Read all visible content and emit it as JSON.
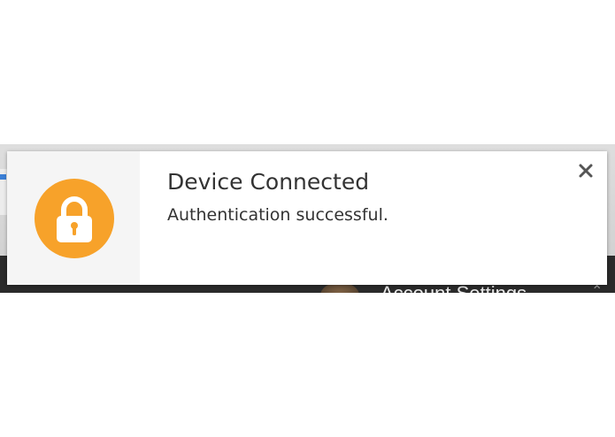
{
  "notification": {
    "title": "Device Connected",
    "message": "Authentication successful.",
    "icon": "lock-icon",
    "close_icon": "close-icon"
  },
  "background_window": {
    "account_text": "Account Settings"
  },
  "colors": {
    "lock_circle": "#f7a22a",
    "icon_panel_bg": "#f5f5f5",
    "text": "#333333",
    "close": "#555555"
  }
}
